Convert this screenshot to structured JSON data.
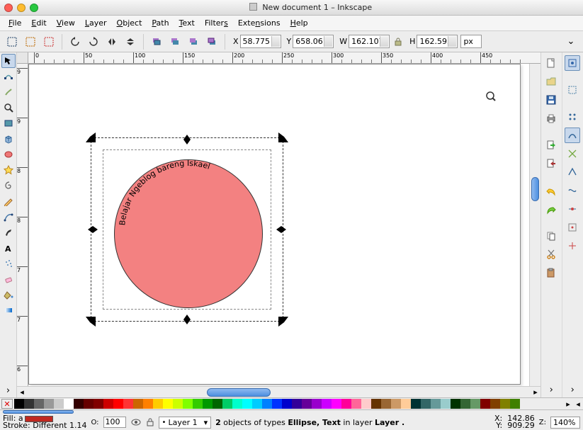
{
  "window": {
    "title": "New document 1 – Inkscape"
  },
  "menu": {
    "items": [
      "File",
      "Edit",
      "View",
      "Layer",
      "Object",
      "Path",
      "Text",
      "Filters",
      "Extensions",
      "Help"
    ]
  },
  "toolbar": {
    "x_label": "X",
    "x": "58.775",
    "y_label": "Y",
    "y": "658.061",
    "w_label": "W",
    "w": "162.107",
    "h_label": "H",
    "h": "162.595",
    "unit": "px"
  },
  "ruler_top": [
    "0",
    "50",
    "100",
    "150",
    "200",
    "250",
    "300",
    "350",
    "400",
    "450"
  ],
  "ruler_left": [
    "9",
    "9",
    "8",
    "8",
    "7",
    "7",
    "6"
  ],
  "canvas": {
    "circle_fill": "#f38181",
    "text_on_path": "Belajar Ngeblog bareng Iskael"
  },
  "palette": {
    "colors": [
      "#000000",
      "#333333",
      "#666666",
      "#999999",
      "#cccccc",
      "#ffffff",
      "#330000",
      "#660000",
      "#800000",
      "#cc0000",
      "#ff0000",
      "#ff3333",
      "#cc6600",
      "#ff8000",
      "#ffcc00",
      "#ffff00",
      "#ccff00",
      "#80ff00",
      "#33cc00",
      "#009900",
      "#006600",
      "#00cc66",
      "#00ffcc",
      "#00ffff",
      "#00ccff",
      "#0080ff",
      "#0033ff",
      "#0000cc",
      "#330099",
      "#660099",
      "#9900cc",
      "#cc00ff",
      "#ff00ff",
      "#ff0099",
      "#ff6699",
      "#ffcccc",
      "#663300",
      "#996633",
      "#cc9966",
      "#ffcc99",
      "#003333",
      "#336666",
      "#669999",
      "#99cccc",
      "#003300",
      "#336633",
      "#669966",
      "#800000",
      "#804000",
      "#808000",
      "#408000"
    ]
  },
  "status": {
    "fill_label": "Fill:",
    "fill_text": "a",
    "stroke_label": "Stroke:",
    "stroke_text": "Different 1.14",
    "opacity_label": "O:",
    "opacity": "100",
    "layer": "Layer 1",
    "message_prefix": "2",
    "message_mid": " objects of types ",
    "message_types": "Ellipse, Text",
    "message_in": " in layer ",
    "message_layer": "Layer .",
    "cursor_x_label": "X:",
    "cursor_x": "142.86",
    "cursor_y_label": "Y:",
    "cursor_y": "909.29",
    "zoom_label": "Z:",
    "zoom": "140%"
  }
}
